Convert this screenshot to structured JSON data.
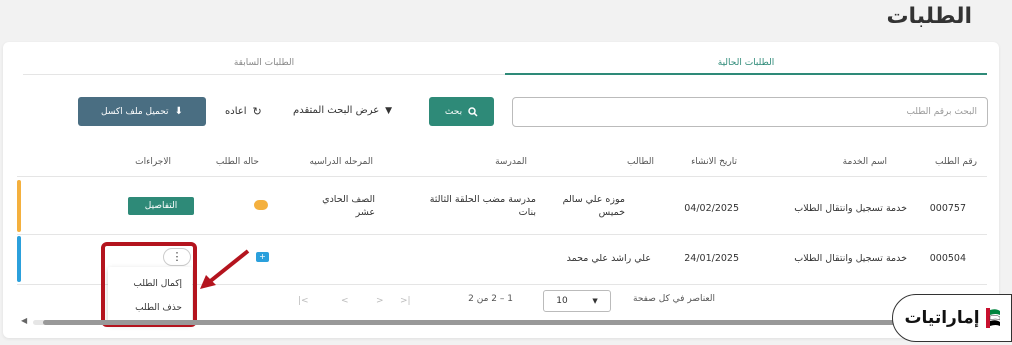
{
  "page_title": "الطلبات",
  "tabs": [
    {
      "label": "الطلبات الحالية",
      "active": true
    },
    {
      "label": "الطلبات السابقة",
      "active": false
    }
  ],
  "search": {
    "placeholder": "البحث برقم الطلب",
    "button_label": "بحث"
  },
  "advanced_search_label": "عرض البحث المتقدم",
  "reset_label": "اعاده",
  "excel_button_label": "تحميل ملف اكسل",
  "table": {
    "headers": [
      "رقم الطلب",
      "اسم الخدمة",
      "تاريخ الانشاء",
      "الطالب",
      "المدرسة",
      "المرحله الدراسيه",
      "حاله الطلب",
      "الاجراءات"
    ],
    "rows": [
      {
        "request_no": "000757",
        "service": "خدمة تسجيل وانتقال الطلاب",
        "date": "04/02/2025",
        "student": "موزه علي سالم خميس",
        "school": "مدرسة مضب الحلقة الثالثة بنات",
        "grade": "الصف الحادي عشر",
        "status_color": "#f4b03e",
        "action_label": "التفاصيل",
        "bar_color": "#f4b03e"
      },
      {
        "request_no": "000504",
        "service": "خدمة تسجيل وانتقال الطلاب",
        "date": "24/01/2025",
        "student": "علي راشد علي محمد",
        "school": "",
        "grade": "",
        "status_color": "#2ba0dc",
        "action_label": "",
        "bar_color": "#2ba0dc"
      }
    ]
  },
  "menu": {
    "items": [
      "إكمال الطلب",
      "حذف الطلب"
    ]
  },
  "pagination": {
    "items_per_page_label": "العناصر في كل صفحة",
    "per_page_value": "10",
    "range_label": "1 – 2 من 2"
  },
  "logo": {
    "text": "إماراتيات"
  }
}
